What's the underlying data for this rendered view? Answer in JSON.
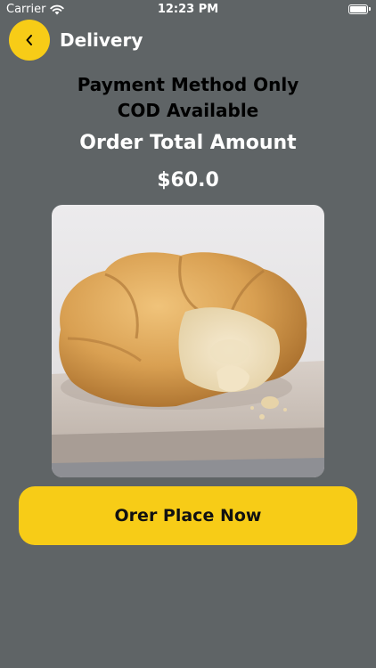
{
  "status_bar": {
    "carrier": "Carrier",
    "time": "12:23 PM",
    "icons": [
      "wifi-icon",
      "battery-icon"
    ]
  },
  "header": {
    "back_icon": "chevron-left-icon",
    "title": "Delivery"
  },
  "payment": {
    "line1": "Payment Method Only",
    "line2": "COD Available"
  },
  "order_total": {
    "label": "Order Total Amount",
    "amount": "$60.0"
  },
  "product": {
    "image": "bread-loaf-photo"
  },
  "actions": {
    "place_order_label": "Orer Place Now"
  },
  "colors": {
    "background": "#5f6466",
    "accent": "#f7cc17",
    "text_light": "#ffffff",
    "text_dark": "#000000"
  }
}
